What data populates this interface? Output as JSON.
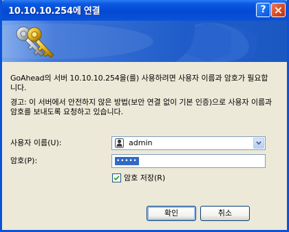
{
  "window": {
    "title": "10.10.10.254에 연결"
  },
  "dialog": {
    "prompt": "GoAhead의 서버 10.10.10.254을(를) 사용하려면 사용자 이름과 암호가 필요합니다.",
    "warning": "경고: 이 서버에서 안전하지 않은 방법(보안 연결 없이 기본 인증)으로 사용자 이름과 암호를 보내도록 요청하고 있습니다."
  },
  "form": {
    "username_label": "사용자 이름(U):",
    "username_value": "admin",
    "password_label": "암호(P):",
    "password_mask": "•••••",
    "remember_label": "암호 저장(R)",
    "remember_checked": true
  },
  "buttons": {
    "ok": "확인",
    "cancel": "취소"
  },
  "icons": {
    "titlebar_help": "help-icon",
    "titlebar_close": "close-icon",
    "banner": "keys-icon",
    "username_combo": "user-icon",
    "combo_arrow": "chevron-down-icon",
    "checkbox": "checkmark-icon"
  },
  "colors": {
    "titlebar": "#0a52d8",
    "banner": "#1e5cc9",
    "dialog_background": "#ece9d8",
    "selection": "#316ac5",
    "close_button": "#d84b22"
  }
}
